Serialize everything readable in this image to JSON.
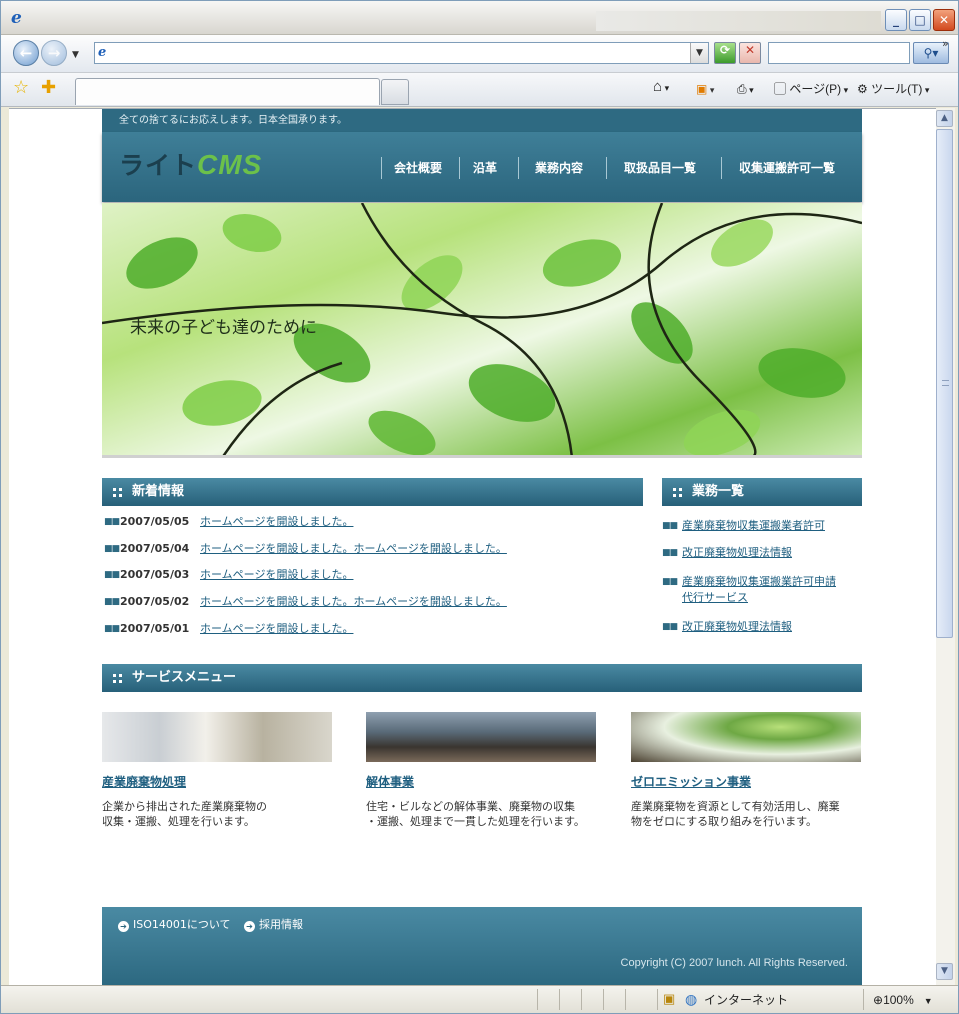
{
  "browser": {
    "menu": {
      "page": "ページ(P)",
      "tools": "ツール(T)"
    },
    "status": {
      "zone": "インターネット",
      "zoom": "100%"
    }
  },
  "site": {
    "tagline": "全ての捨てるにお応えします。日本全国承ります。",
    "logo": {
      "prefix": "ライト",
      "suffix": "CMS"
    },
    "nav": [
      "会社概要",
      "沿革",
      "業務内容",
      "取扱品目一覧",
      "収集運搬許可一覧"
    ],
    "hero_text": "未来の子ども達のために",
    "news": {
      "heading": "新着情報",
      "items": [
        {
          "date": "2007/05/05",
          "text": "ホームページを開設しました。"
        },
        {
          "date": "2007/05/04",
          "text": "ホームページを開設しました。ホームページを開設しました。"
        },
        {
          "date": "2007/05/03",
          "text": "ホームページを開設しました。"
        },
        {
          "date": "2007/05/02",
          "text": "ホームページを開設しました。ホームページを開設しました。"
        },
        {
          "date": "2007/05/01",
          "text": "ホームページを開設しました。"
        }
      ]
    },
    "business": {
      "heading": "業務一覧",
      "items": [
        {
          "line1": "産業廃棄物収集運搬業者許可",
          "line2": ""
        },
        {
          "line1": "改正廃棄物処理法情報",
          "line2": ""
        },
        {
          "line1": "産業廃棄物収集運搬業許可申請",
          "line2": "代行サービス"
        },
        {
          "line1": "改正廃棄物処理法情報",
          "line2": ""
        }
      ]
    },
    "services": {
      "heading": "サービスメニュー",
      "items": [
        {
          "title": "産業廃棄物処理",
          "desc1": "企業から排出された産業廃棄物の",
          "desc2": "収集・運搬、処理を行います。"
        },
        {
          "title": "解体事業",
          "desc1": "住宅・ビルなどの解体事業、廃棄物の収集",
          "desc2": "・運搬、処理まで一貫した処理を行います。"
        },
        {
          "title": "ゼロエミッション事業",
          "desc1": "産業廃棄物を資源として有効活用し、廃棄",
          "desc2": "物をゼロにする取り組みを行います。"
        }
      ]
    },
    "footer": {
      "links": [
        "ISO14001について",
        "採用情報"
      ],
      "copyright": "Copyright (C) 2007 lunch. All Rights Reserved."
    }
  }
}
